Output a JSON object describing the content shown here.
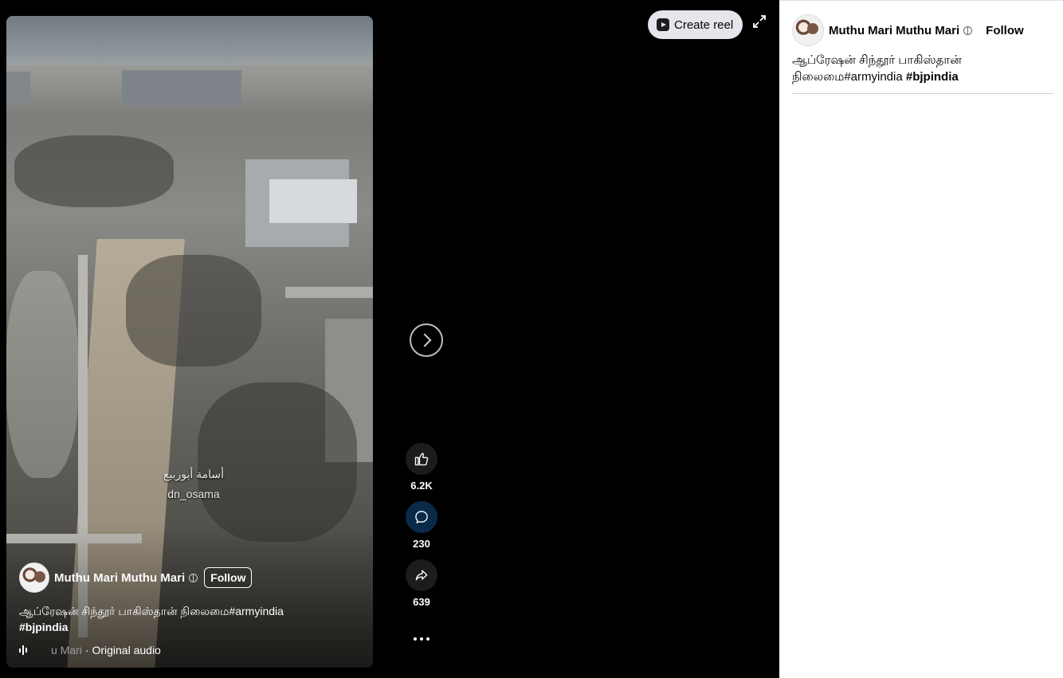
{
  "reel": {
    "author_name": "Muthu Mari Muthu Mari",
    "follow_label": "Follow",
    "caption_text": "ஆப்ரேஷன் சிந்தூர் பாகிஸ்தான் நிலைமை#armyindia",
    "caption_hashtag": "#bjpindia",
    "audio_author": "Muthu Mari",
    "audio_author_visible": "u Mari",
    "audio_label": "· Original audio",
    "watermark_line1": "أسامة أبوربيع",
    "watermark_line2": "dn_osama"
  },
  "actions": {
    "likes": "6.2K",
    "comments": "230",
    "shares": "639"
  },
  "toolbar": {
    "create_reel_label": "Create reel"
  },
  "panel": {
    "author_name": "Muthu Mari Muthu Mari",
    "follow_label": "Follow",
    "caption_line1": "ஆப்ரேஷன் சிந்தூர் பாகிஸ்தான்",
    "caption_line2": "நிலைமை#armyindia ",
    "caption_hashtag": "#bjpindia"
  },
  "colors": {
    "stage_background": "#000000",
    "panel_background": "#ffffff",
    "comment_button": "#0a2a4a"
  },
  "icons": [
    "like-icon",
    "comment-icon",
    "share-icon",
    "more-icon",
    "next-icon",
    "expand-icon",
    "reel-icon",
    "globe-icon",
    "audio-icon"
  ]
}
